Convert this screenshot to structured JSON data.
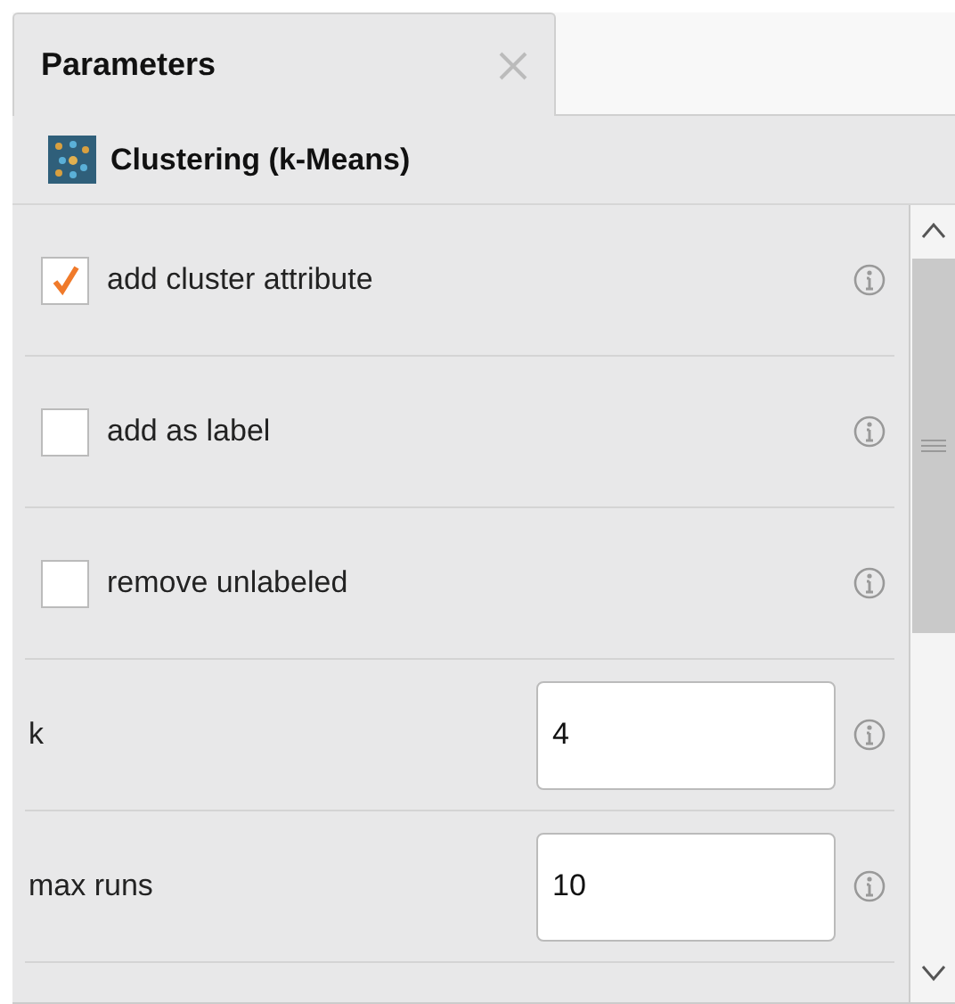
{
  "tabs": [
    {
      "label": "Parameters",
      "selected": true
    }
  ],
  "operator": {
    "title": "Clustering (k-Means)"
  },
  "parameters": [
    {
      "kind": "checkbox",
      "label": "add cluster attribute",
      "checked": true
    },
    {
      "kind": "checkbox",
      "label": "add as label",
      "checked": false
    },
    {
      "kind": "checkbox",
      "label": "remove unlabeled",
      "checked": false
    },
    {
      "kind": "number",
      "label": "k",
      "value": "4"
    },
    {
      "kind": "number",
      "label": "max runs",
      "value": "10"
    }
  ]
}
